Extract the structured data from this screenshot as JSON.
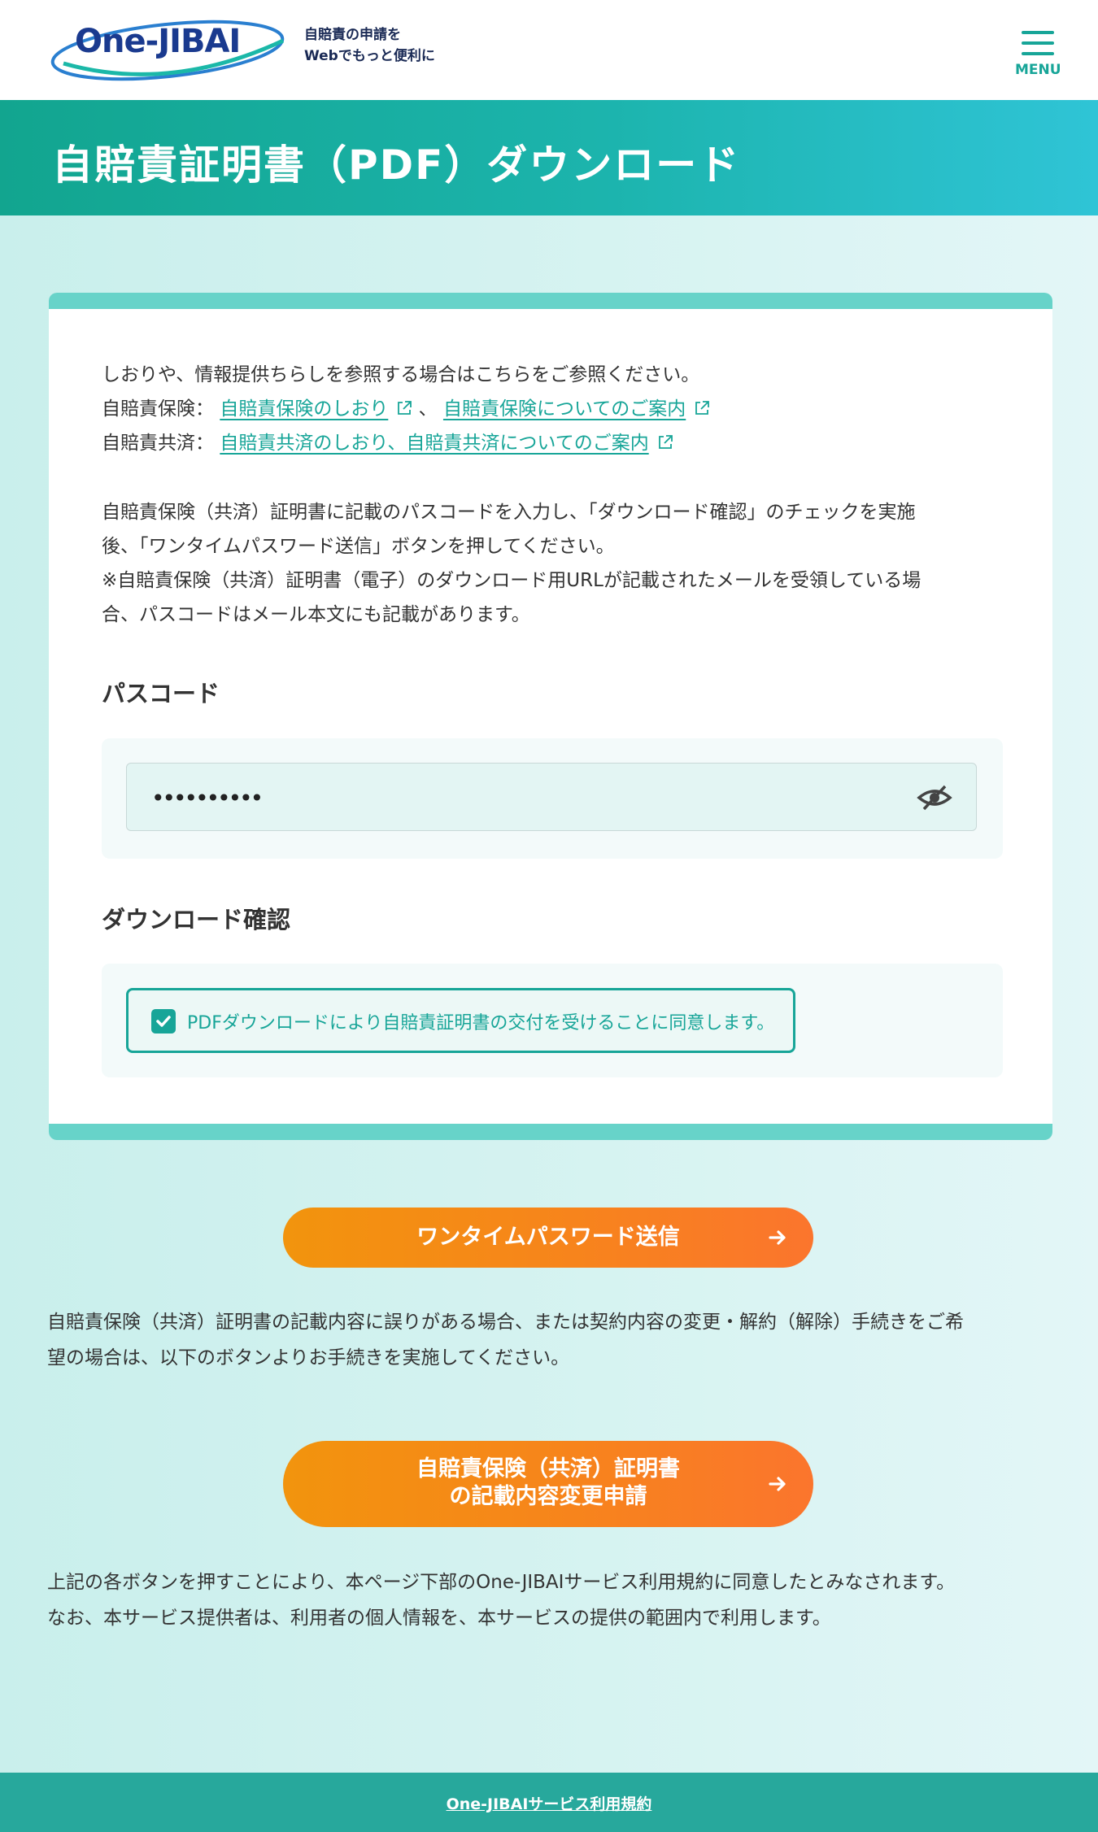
{
  "header": {
    "logo_text": "One-JIBAI",
    "tagline_line1": "自賠責の申請を",
    "tagline_line2": "Webでもっと便利に",
    "menu_label": "MENU"
  },
  "banner": {
    "title": "自賠責証明書（PDF）ダウンロード"
  },
  "intro": {
    "line1": "しおりや、情報提供ちらしを参照する場合はこちらをご参照ください。",
    "insurance_label": "自賠責保険：",
    "insurance_link1": "自賠責保険のしおり",
    "separator": "、",
    "insurance_link2": "自賠責保険についてのご案内",
    "mutual_label": "自賠責共済：",
    "mutual_link": "自賠責共済のしおり、自賠責共済についてのご案内"
  },
  "instructions": {
    "line1": "自賠責保険（共済）証明書に記載のパスコードを入力し、「ダウンロード確認」のチェックを実施",
    "line2": "後、「ワンタイムパスワード送信」ボタンを押してください。",
    "line3": "※自賠責保険（共済）証明書（電子）のダウンロード用URLが記載されたメールを受領している場",
    "line4": "合、パスコードはメール本文にも記載があります。"
  },
  "passcode": {
    "heading": "パスコード",
    "masked_value": "••••••••••",
    "icon": "eye-slash-icon"
  },
  "download_confirm": {
    "heading": "ダウンロード確認",
    "checked": true,
    "label": "PDFダウンロードにより自賠責証明書の交付を受けることに同意します。"
  },
  "otp_button": {
    "label": "ワンタイムパスワード送信"
  },
  "change_note": {
    "line1": "自賠責保険（共済）証明書の記載内容に誤りがある場合、または契約内容の変更・解約（解除）手続きをご希",
    "line2": "望の場合は、以下のボタンよりお手続きを実施してください。"
  },
  "change_button": {
    "line1": "自賠責保険（共済）証明書",
    "line2": "の記載内容変更申請"
  },
  "agreement": {
    "line1": "上記の各ボタンを押すことにより、本ページ下部のOne-JIBAIサービス利用規約に同意したとみなされます。",
    "line2": "なお、本サービス提供者は、利用者の個人情報を、本サービスの提供の範囲内で利用します。"
  },
  "footer": {
    "terms_link": "One-JIBAIサービス利用規約"
  },
  "colors": {
    "accent": "#17a598",
    "banner_start": "#12a58f",
    "banner_end": "#2fc4d6",
    "button_start": "#f2940d",
    "button_end": "#fb752d"
  }
}
